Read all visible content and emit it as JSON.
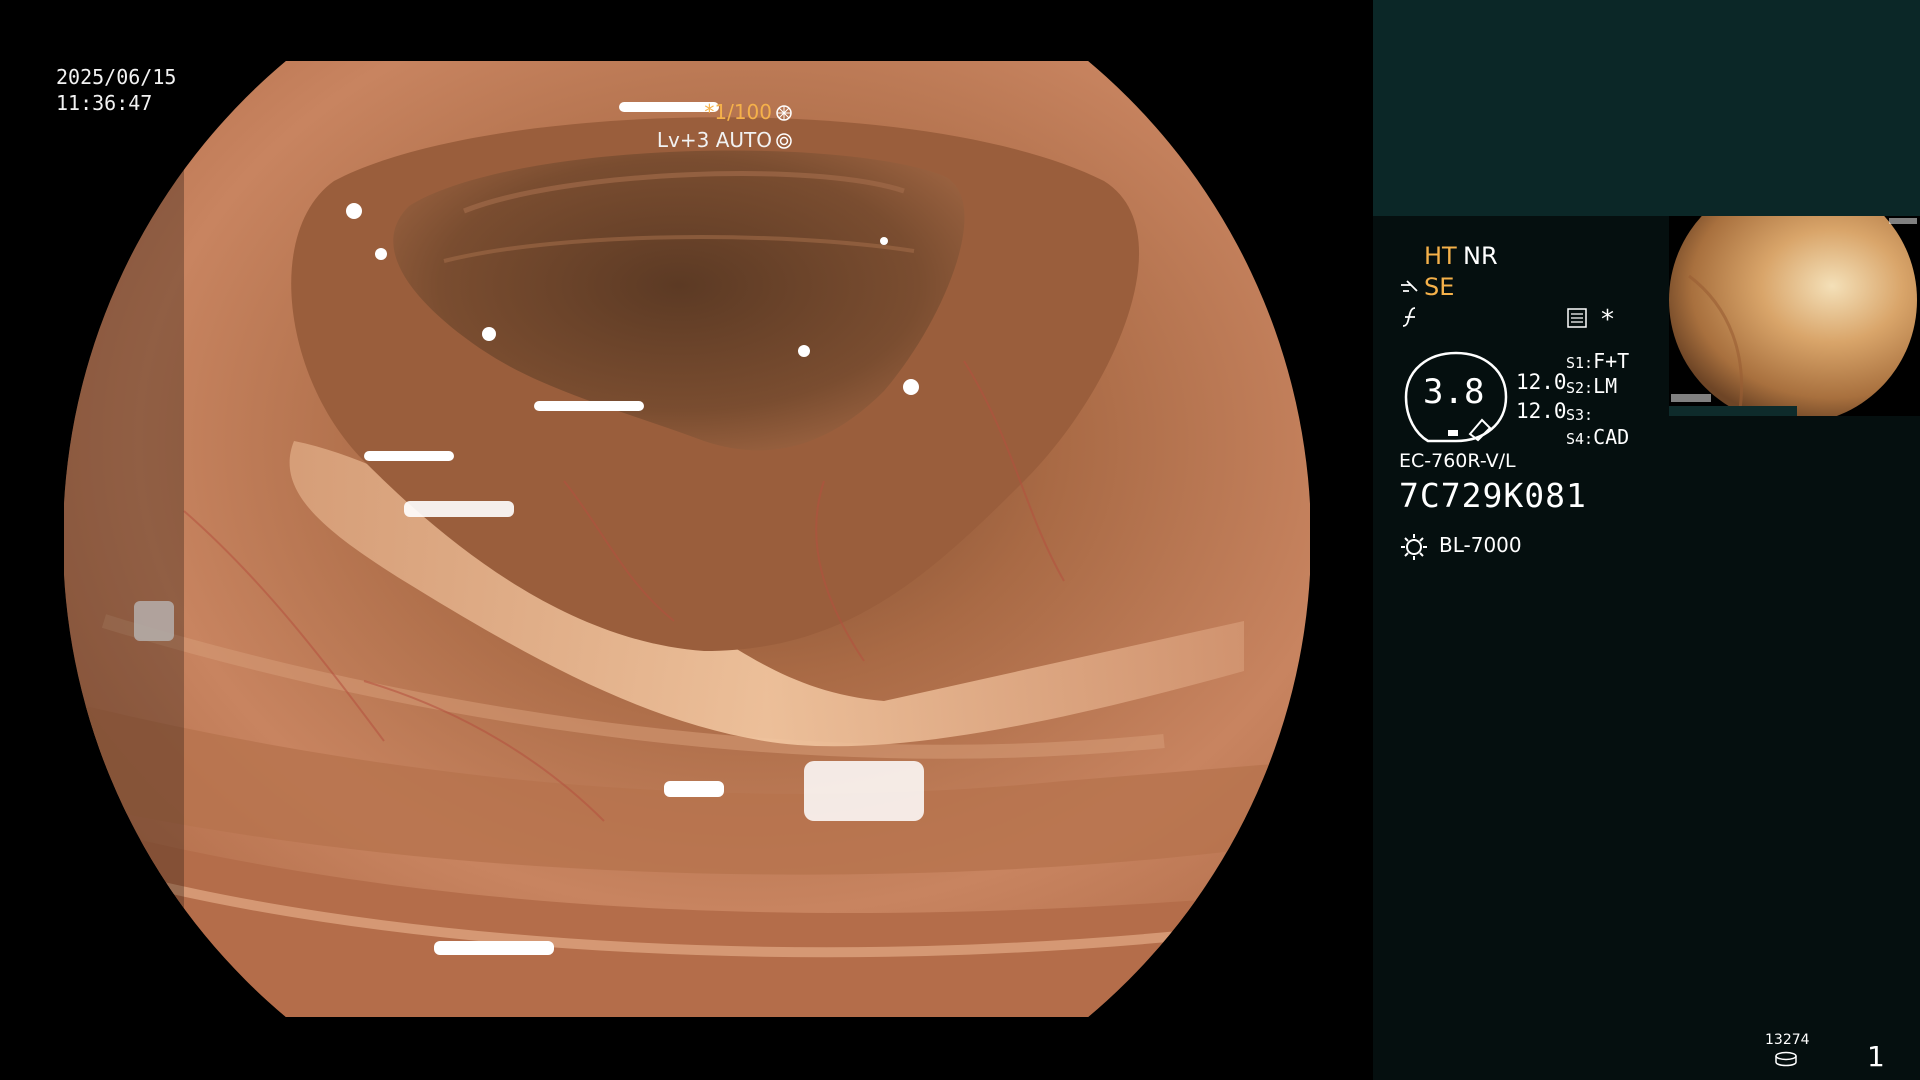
{
  "main": {
    "date": "2025/06/15",
    "time": "11:36:47",
    "shutter": "*1/100",
    "shutter_icon": "aperture-icon",
    "level": "Lv+3 AUTO",
    "level_icon": "auto-iris-icon"
  },
  "panel": {
    "ht": "HT",
    "nr": "NR",
    "se": "SE",
    "se_icon": "se-mode-icon",
    "enhance_icon": "enhance-icon",
    "menu_icon": "menu-icon",
    "star": "*",
    "iris_value": "3.8",
    "value_a": "12.0",
    "value_b": "12.0",
    "switches": [
      {
        "key": "S1:",
        "value": "F+T"
      },
      {
        "key": "S2:",
        "value": "LM"
      },
      {
        "key": "S3:",
        "value": ""
      },
      {
        "key": "S4:",
        "value": "CAD"
      }
    ],
    "scope_model": "EC-760R-V/L",
    "scope_serial": "7C729K081",
    "lamp_icon": "light-source-icon",
    "light_source": "BL-7000",
    "image_count": "13274",
    "disk_icon": "storage-icon",
    "page_number": "1"
  },
  "colors": {
    "accent_orange": "#f5b14a",
    "panel_top": "#0b2727",
    "panel_bg": "#050f0f"
  }
}
